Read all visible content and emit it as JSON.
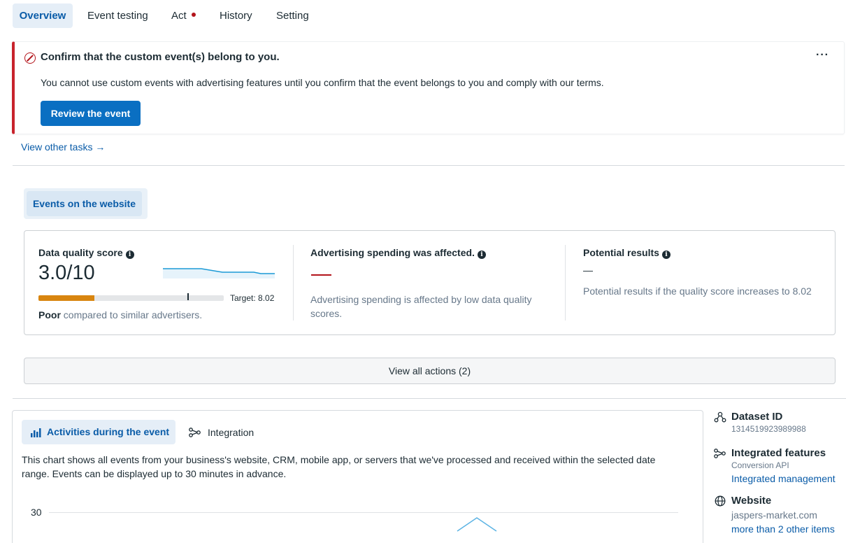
{
  "tabs": [
    {
      "label": "Overview",
      "active": true
    },
    {
      "label": "Event testing",
      "active": false
    },
    {
      "label": "Act",
      "active": false,
      "has_dot": true
    },
    {
      "label": "History",
      "active": false
    },
    {
      "label": "Setting",
      "active": false
    }
  ],
  "alert": {
    "title": "Confirm that the custom event(s) belong to you.",
    "more": "···",
    "body": "You cannot use custom events with advertising features until you confirm that the event belongs to you and comply with our terms.",
    "button": "Review the event"
  },
  "view_other_tasks": "View other tasks →",
  "events_tab": "Events on the website",
  "metrics": {
    "quality": {
      "title": "Data quality score",
      "score": "3.0/10",
      "score_fraction": 0.3,
      "target_fraction": 0.802,
      "target_label": "Target: 8.02",
      "rating": "Poor",
      "rating_suffix": " compared to similar advertisers."
    },
    "spending": {
      "title": "Advertising spending was affected.",
      "desc": "Advertising spending is affected by low data quality scores."
    },
    "potential": {
      "title": "Potential results",
      "value": "—",
      "desc": "Potential results if the quality score increases to 8.02"
    }
  },
  "view_all_actions": "View all actions (2)",
  "activities": {
    "tab_active": "Activities during the event",
    "tab_other": "Integration",
    "description": "This chart shows all events from your business's website, CRM, mobile app, or servers that we've processed and received within the selected date range. Events can be displayed up to 30 minutes in advance.",
    "y_tick": "30"
  },
  "side": {
    "dataset_title": "Dataset ID",
    "dataset_id": "1314519923989988",
    "features_title": "Integrated features",
    "features_sub": "Conversion API",
    "features_link": "Integrated management",
    "website_title": "Website",
    "website_value": "jaspers-market.com",
    "website_more": "more than 2 other items"
  },
  "colors": {
    "accent": "#0a5ca8",
    "primary_button": "#0a6fc2",
    "error": "#b3141b",
    "score_bar": "#d8850f",
    "sparkline": "#1b9ad6"
  }
}
